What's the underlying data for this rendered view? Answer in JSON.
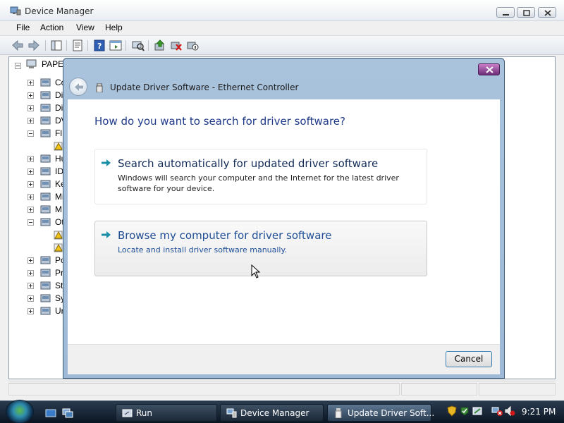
{
  "window": {
    "title": "Device Manager",
    "menus": [
      "File",
      "Action",
      "View",
      "Help"
    ]
  },
  "tree": {
    "root": "PAPER",
    "items": [
      {
        "label": "Co",
        "icon": "computer-icon",
        "expanded": false
      },
      {
        "label": "Di",
        "icon": "disk-drive-icon",
        "expanded": false
      },
      {
        "label": "Di",
        "icon": "display-adapter-icon",
        "expanded": false
      },
      {
        "label": "DV",
        "icon": "dvd-drive-icon",
        "expanded": false
      },
      {
        "label": "Fl",
        "icon": "floppy-controller-icon",
        "expanded": true
      },
      {
        "label": "",
        "icon": "floppy-warning-icon",
        "expanded": null
      },
      {
        "label": "Hu",
        "icon": "hid-icon",
        "expanded": false
      },
      {
        "label": "ID",
        "icon": "ide-controller-icon",
        "expanded": false
      },
      {
        "label": "Ke",
        "icon": "keyboard-icon",
        "expanded": false
      },
      {
        "label": "Mi",
        "icon": "mouse-icon",
        "expanded": false
      },
      {
        "label": "M",
        "icon": "monitor-icon",
        "expanded": false
      },
      {
        "label": "Ot",
        "icon": "other-devices-icon",
        "expanded": true
      },
      {
        "label": "",
        "icon": "unknown-device-warning-icon",
        "expanded": null
      },
      {
        "label": "",
        "icon": "unknown-device-warning-icon",
        "expanded": null
      },
      {
        "label": "Po",
        "icon": "ports-icon",
        "expanded": false
      },
      {
        "label": "Pr",
        "icon": "processor-icon",
        "expanded": false
      },
      {
        "label": "St",
        "icon": "storage-icon",
        "expanded": false
      },
      {
        "label": "Sy",
        "icon": "system-devices-icon",
        "expanded": false
      },
      {
        "label": "Ur",
        "icon": "usb-icon",
        "expanded": false
      }
    ]
  },
  "dialog": {
    "title": "Update Driver Software - Ethernet Controller",
    "heading": "How do you want to search for driver software?",
    "options": [
      {
        "title": "Search automatically for updated driver software",
        "description": "Windows will search your computer and the Internet for the latest driver software for your device."
      },
      {
        "title": "Browse my computer for driver software",
        "description": "Locate and install driver software manually."
      }
    ],
    "cancel_label": "Cancel"
  },
  "taskbar": {
    "buttons": [
      {
        "label": "Run",
        "icon": "run-icon"
      },
      {
        "label": "Device Manager",
        "icon": "device-manager-icon"
      },
      {
        "label": "Update Driver Soft...",
        "icon": "update-driver-icon"
      }
    ],
    "clock": "9:21 PM"
  },
  "colors": {
    "heading": "#1f3a8a",
    "option_title": "#122a57",
    "dialog_frame": "#9fbad6",
    "taskbar": "#1b2837"
  }
}
